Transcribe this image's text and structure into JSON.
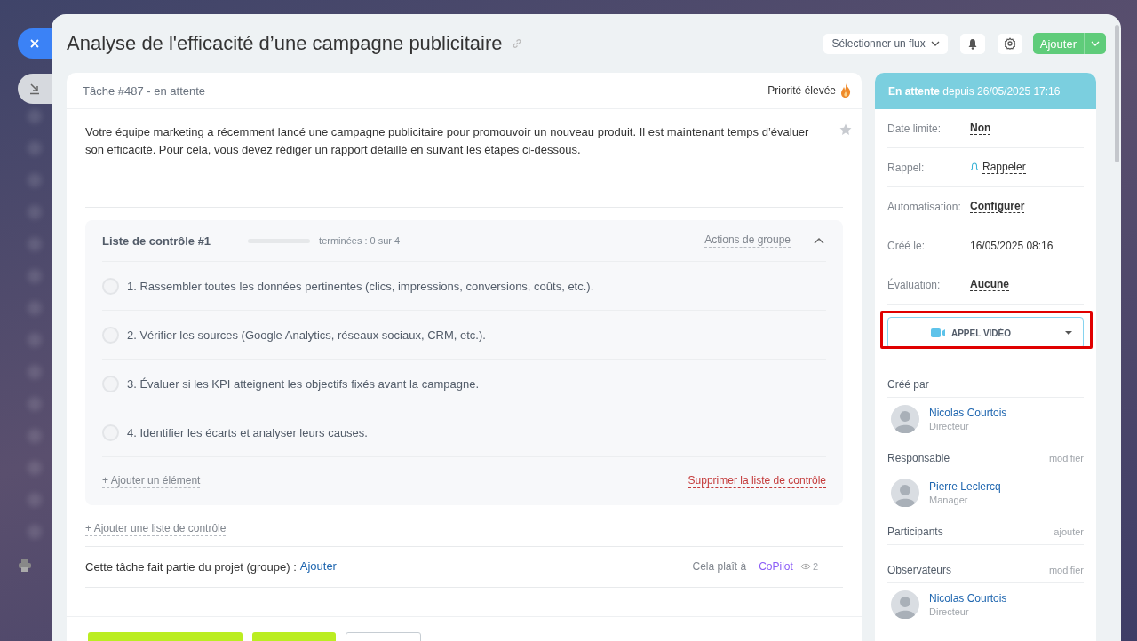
{
  "window": {
    "title": "Analyse de l'efficacité d’une campagne publicitaire"
  },
  "toolbar": {
    "flow_select": "Sélectionner un flux",
    "add_button": "Ajouter"
  },
  "task": {
    "header": "Tâche #487 - en attente",
    "priority": "Priorité élevée",
    "starred": false,
    "description": "Votre équipe marketing a récemment lancé une campagne publicitaire pour promouvoir un nouveau produit. Il est maintenant temps d’évaluer son efficacité. Pour cela, vous devez rédiger un rapport détaillé en suivant les étapes ci-dessous.",
    "checklist": {
      "title": "Liste de contrôle #1",
      "level": 0,
      "progress_text": "terminées : 0 sur 4",
      "actions": "Actions de groupe",
      "expanded": true,
      "items": [
        {
          "text": "1. Rassembler toutes les données pertinentes (clics, impressions, conversions, coûts, etc.).",
          "checked": false
        },
        {
          "text": "2. Vérifier les sources (Google Analytics, réseaux sociaux, CRM, etc.).",
          "checked": false
        },
        {
          "text": "3. Évaluer si les KPI atteignent les objectifs fixés avant la campagne.",
          "checked": false
        },
        {
          "text": "4. Identifier les écarts et analyser leurs causes.",
          "checked": false
        }
      ],
      "add_item": "+ Ajouter un élément",
      "delete": "Supprimer la liste de contrôle"
    },
    "add_checklist": "+ Ajouter une liste de contrôle",
    "project": {
      "label": "Cette tâche fait partie du projet (groupe) :",
      "link": "Ajouter",
      "likes_label": "Cela plaît à",
      "liker": "CoPilot",
      "views": "2"
    },
    "footer_buttons": [
      {
        "kind": "primary"
      },
      {
        "kind": "primary"
      },
      {
        "kind": "outline"
      }
    ]
  },
  "sidebar": {
    "status": {
      "state": "En attente",
      "since": "depuis 26/05/2025 17:16"
    },
    "fields": [
      {
        "label": "Date limite:",
        "value": "Non",
        "kind": "strong"
      },
      {
        "label": "Rappel:",
        "value": "Rappeler",
        "kind": "bell"
      },
      {
        "label": "Automatisation:",
        "value": "Configurer",
        "kind": "strong"
      },
      {
        "label": "Créé le:",
        "value": "16/05/2025 08:16",
        "kind": "plain"
      },
      {
        "label": "Évaluation:",
        "value": "Aucune",
        "kind": "strong"
      }
    ],
    "video_call": "APPEL VIDÉO",
    "roles": [
      {
        "title": "Créé par",
        "people": [
          {
            "name": "Nicolas Courtois",
            "role": "Directeur"
          }
        ]
      },
      {
        "title": "Responsable",
        "action": "modifier",
        "people": [
          {
            "name": "Pierre Leclercq",
            "role": "Manager"
          }
        ]
      },
      {
        "title": "Participants",
        "action": "ajouter"
      },
      {
        "title": "Observateurs",
        "action": "modifier",
        "people": [
          {
            "name": "Nicolas Courtois",
            "role": "Directeur"
          }
        ]
      }
    ]
  }
}
